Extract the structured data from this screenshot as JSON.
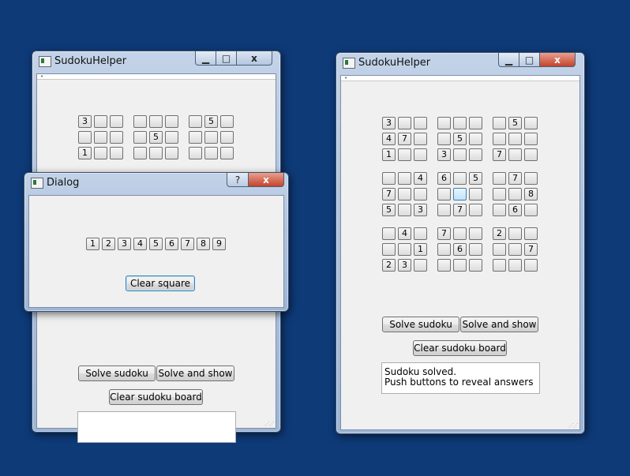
{
  "app_title": "SudokuHelper",
  "dialog_title": "Dialog",
  "help_glyph": "?",
  "close_glyph": "x",
  "board_left": {
    "r1": [
      "3",
      "",
      "",
      "",
      "",
      "",
      "",
      "5",
      ""
    ],
    "r2": [
      "",
      "",
      "",
      "",
      "5",
      "",
      "",
      "",
      ""
    ],
    "r3": [
      "1",
      "",
      "",
      "",
      "",
      "",
      "",
      "",
      ""
    ]
  },
  "board_right": {
    "r1": [
      "3",
      "",
      "",
      "",
      "",
      "",
      "",
      "5",
      ""
    ],
    "r2": [
      "4",
      "7",
      "",
      "",
      "5",
      "",
      "",
      "",
      ""
    ],
    "r3": [
      "1",
      "",
      "",
      "3",
      "",
      "",
      "7",
      "",
      ""
    ],
    "r4": [
      "",
      "",
      "4",
      "6",
      "",
      "5",
      "",
      "7",
      ""
    ],
    "r5": [
      "7",
      "",
      "",
      "",
      "",
      "",
      "",
      "",
      "8"
    ],
    "r6": [
      "5",
      "",
      "3",
      "",
      "7",
      "",
      "",
      "6",
      ""
    ],
    "r7": [
      "",
      "4",
      "",
      "7",
      "",
      "",
      "2",
      "",
      ""
    ],
    "r8": [
      "",
      "",
      "1",
      "",
      "6",
      "",
      "",
      "",
      "7"
    ],
    "r9": [
      "2",
      "3",
      "",
      "",
      "",
      "",
      "",
      "",
      ""
    ]
  },
  "dialog_numbers": [
    "1",
    "2",
    "3",
    "4",
    "5",
    "6",
    "7",
    "8",
    "9"
  ],
  "buttons": {
    "solve": "Solve sudoku",
    "solve_show": "Solve and show",
    "clear_board": "Clear sudoku board",
    "clear_square": "Clear square"
  },
  "output_right": {
    "line1": "Sudoku solved.",
    "line2": "Push buttons to reveal answers"
  }
}
